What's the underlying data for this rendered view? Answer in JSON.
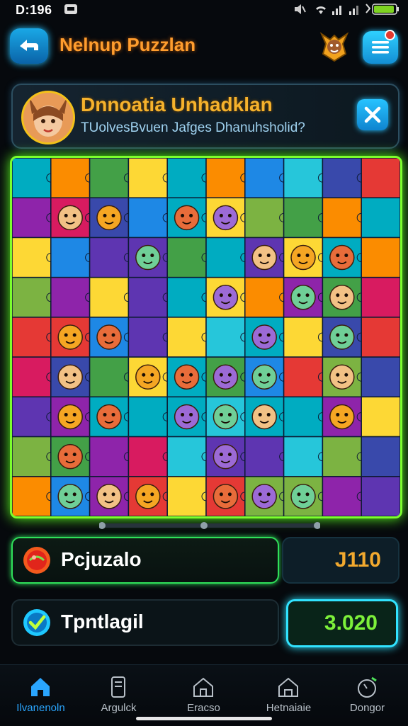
{
  "status": {
    "time": "D:196"
  },
  "header": {
    "title": "Nelnup Puzzlan"
  },
  "banner": {
    "title": "Dnnoatia Unhadklan",
    "subtitle": "TUolvesBvuen Jafges Dhanuhsholid?"
  },
  "puzzle": {
    "palette": [
      "#1e88e5",
      "#43a047",
      "#fdd835",
      "#8e24aa",
      "#e53935",
      "#00acc1",
      "#fb8c00",
      "#3949ab",
      "#7cb342",
      "#d81b60",
      "#26c6da",
      "#5e35b1"
    ],
    "figures": [
      "bird",
      "fox",
      "lizard",
      "monkey",
      "cat",
      "ufo",
      "arrow",
      "crab",
      "girl",
      "drop",
      "unicorn",
      "bear",
      "shield",
      "coin",
      "fox",
      "cup",
      "owl",
      "ear",
      "ghost",
      "boy",
      "elf",
      "pig",
      "cat",
      "bear",
      "sun",
      "bear",
      "crab",
      "fox",
      "fish",
      "sun",
      "boy",
      "smiley",
      "dog",
      "girl",
      "man"
    ]
  },
  "score_rows": [
    {
      "label": "Pcjuzalo",
      "value": "J110",
      "icon": "red-gem-icon"
    },
    {
      "label": "Tpntlagil",
      "value": "3.020",
      "icon": "check-badge-icon"
    }
  ],
  "nav": [
    {
      "label": "Ilvanenoln",
      "icon": "home-icon",
      "active": true
    },
    {
      "label": "Argulck",
      "icon": "tablet-icon",
      "active": false
    },
    {
      "label": "Eracso",
      "icon": "house-icon",
      "active": false
    },
    {
      "label": "Hetnaiaie",
      "icon": "house-outline-icon",
      "active": false
    },
    {
      "label": "Dongor",
      "icon": "timer-icon",
      "active": false
    }
  ]
}
